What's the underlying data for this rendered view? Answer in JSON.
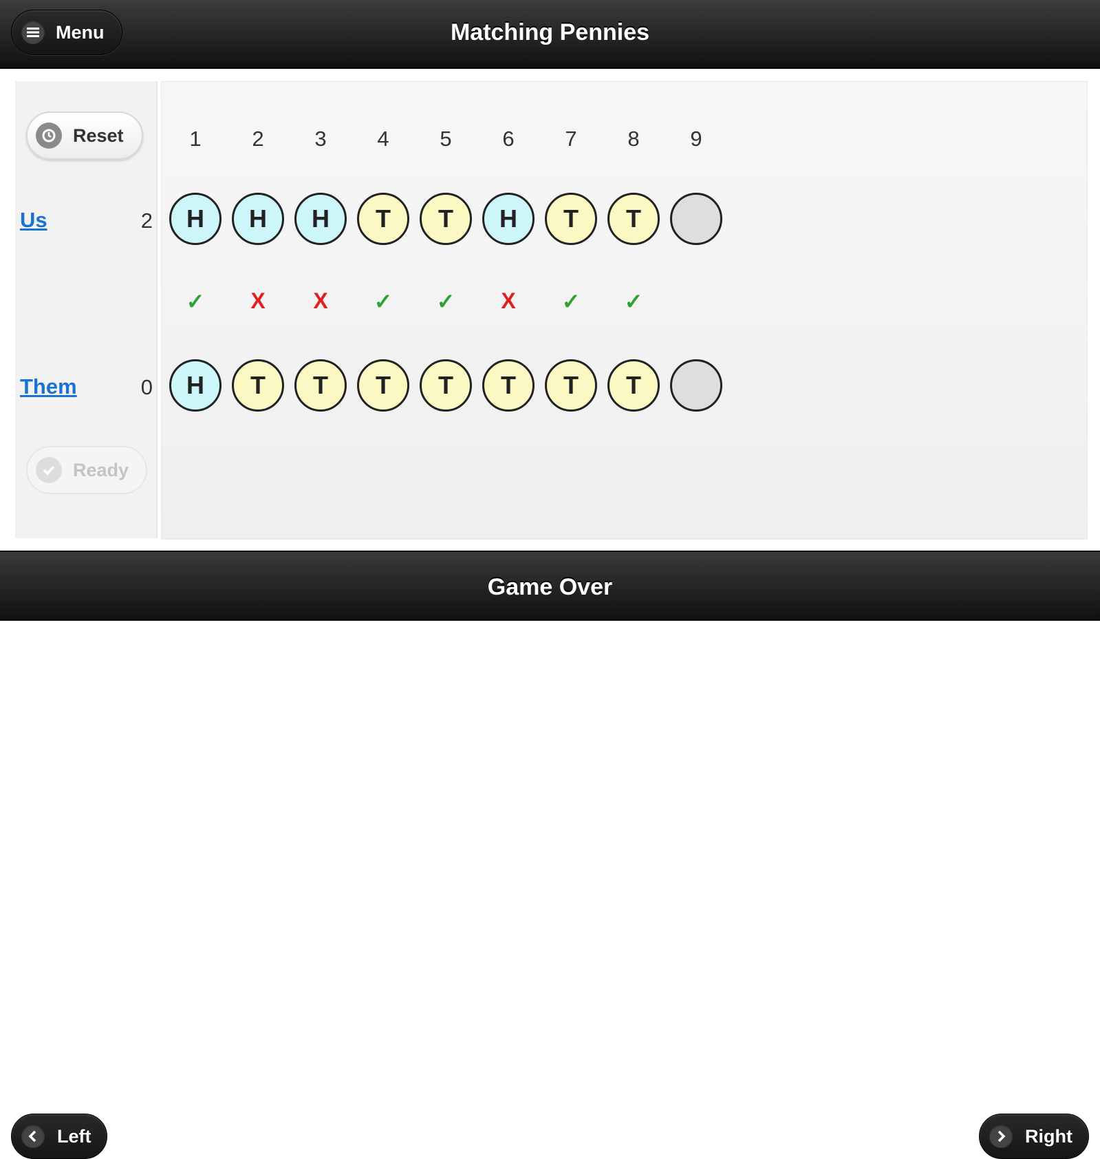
{
  "header": {
    "title": "Matching Pennies",
    "menu_label": "Menu"
  },
  "footer": {
    "status": "Game Over",
    "left_label": "Left",
    "right_label": "Right"
  },
  "controls": {
    "reset_label": "Reset",
    "ready_label": "Ready"
  },
  "rounds": [
    "1",
    "2",
    "3",
    "4",
    "5",
    "6",
    "7",
    "8",
    "9"
  ],
  "players": {
    "us": {
      "label": "Us",
      "score": "2",
      "coins": [
        "H",
        "H",
        "H",
        "T",
        "T",
        "H",
        "T",
        "T",
        ""
      ]
    },
    "them": {
      "label": "Them",
      "score": "0",
      "coins": [
        "H",
        "T",
        "T",
        "T",
        "T",
        "T",
        "T",
        "T",
        ""
      ]
    }
  },
  "results": [
    "✓",
    "X",
    "X",
    "✓",
    "✓",
    "X",
    "✓",
    "✓"
  ],
  "colors": {
    "heads": "#cdf6fb",
    "tails": "#fbf8c3",
    "empty": "#dedede",
    "match": "#2aa332",
    "miss": "#e02020",
    "link": "#1a73d1"
  }
}
